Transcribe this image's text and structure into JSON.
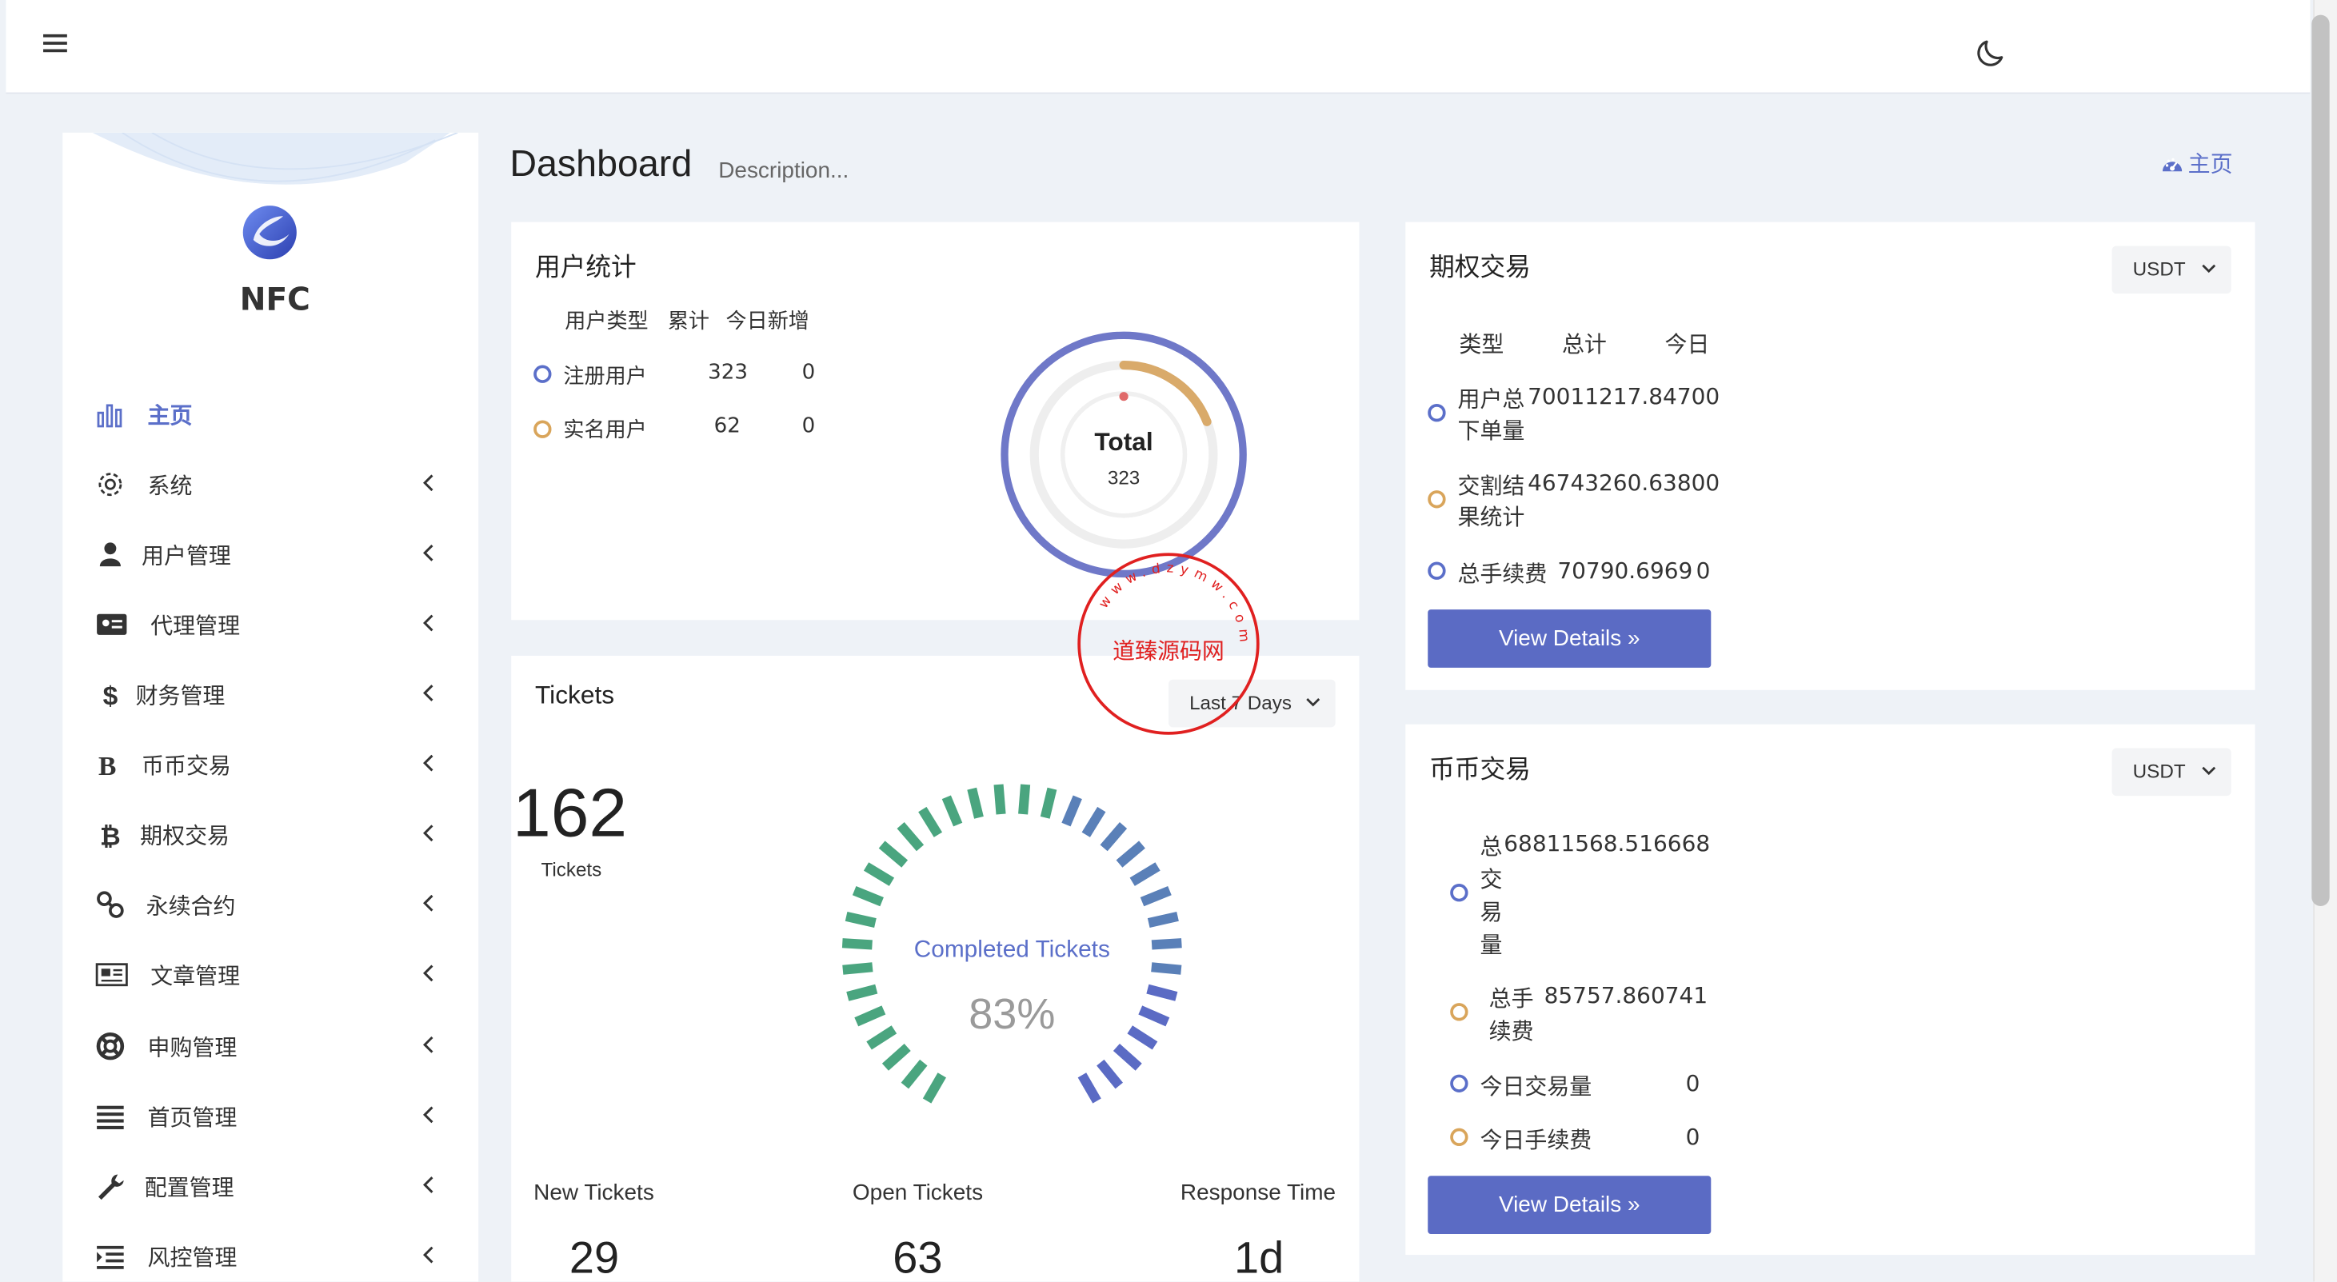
{
  "topbar": {},
  "brand": {
    "name": "NFC"
  },
  "sidebar": {
    "items": [
      {
        "label": "主页",
        "icon": "bar-chart-icon",
        "active": true
      },
      {
        "label": "系统",
        "icon": "gear-icon"
      },
      {
        "label": "用户管理",
        "icon": "user-icon"
      },
      {
        "label": "代理管理",
        "icon": "id-card-icon"
      },
      {
        "label": "财务管理",
        "icon": "dollar-icon"
      },
      {
        "label": "币币交易",
        "icon": "bold-b-icon"
      },
      {
        "label": "期权交易",
        "icon": "bitcoin-icon"
      },
      {
        "label": "永续合约",
        "icon": "link-icon"
      },
      {
        "label": "文章管理",
        "icon": "newspaper-icon"
      },
      {
        "label": "申购管理",
        "icon": "lifebuoy-icon"
      },
      {
        "label": "首页管理",
        "icon": "list-icon"
      },
      {
        "label": "配置管理",
        "icon": "wrench-icon"
      },
      {
        "label": "风控管理",
        "icon": "indent-list-icon"
      }
    ]
  },
  "header": {
    "title": "Dashboard",
    "description": "Description...",
    "home_link": "主页"
  },
  "user_stats": {
    "title": "用户统计",
    "columns": [
      "用户类型",
      "累计",
      "今日新增"
    ],
    "rows": [
      {
        "type": "注册用户",
        "total": "323",
        "today": "0"
      },
      {
        "type": "实名用户",
        "total": "62",
        "today": "0"
      }
    ],
    "donut_label": "Total",
    "donut_value": "323",
    "ring_fraction": 0.19
  },
  "tickets": {
    "title": "Tickets",
    "range_select": "Last 7 Days",
    "count": "162",
    "count_label": "Tickets",
    "gauge_label": "Completed Tickets",
    "gauge_value": "83%",
    "gauge_fraction": 0.83,
    "footer": [
      {
        "label": "New Tickets",
        "value": "29"
      },
      {
        "label": "Open Tickets",
        "value": "63"
      },
      {
        "label": "Response Time",
        "value": "1d"
      }
    ]
  },
  "options_trading": {
    "title": "期权交易",
    "currency": "USDT",
    "columns": [
      "类型",
      "总计",
      "今日"
    ],
    "rows": [
      {
        "label1": "用户总",
        "label2": "下单量",
        "total": "70011217.84700",
        "today": ""
      },
      {
        "label1": "交割结",
        "label2": "果统计",
        "total": "46743260.63800",
        "today": ""
      },
      {
        "label1": "总手续费",
        "label2": "",
        "total": "70790.6969",
        "today": "0"
      }
    ],
    "button": "View Details"
  },
  "coin_trading": {
    "title": "币币交易",
    "currency": "USDT",
    "row1": {
      "prefix": "总",
      "value": "68811568.516668",
      "chars": [
        "交",
        "易",
        "量"
      ]
    },
    "row2": {
      "label1": "总手",
      "label2": "续费",
      "value": "85757.860741"
    },
    "row3": {
      "label": "今日交易量",
      "value": "0"
    },
    "row4": {
      "label": "今日手续费",
      "value": "0"
    },
    "button": "View Details"
  },
  "watermark": {
    "center": "道臻源码网",
    "ring": "www.dzymw.com"
  },
  "colors": {
    "accent": "#5b6fc9",
    "button": "#5b6bc4",
    "orange": "#d9a55b",
    "green": "#4aa57f"
  }
}
